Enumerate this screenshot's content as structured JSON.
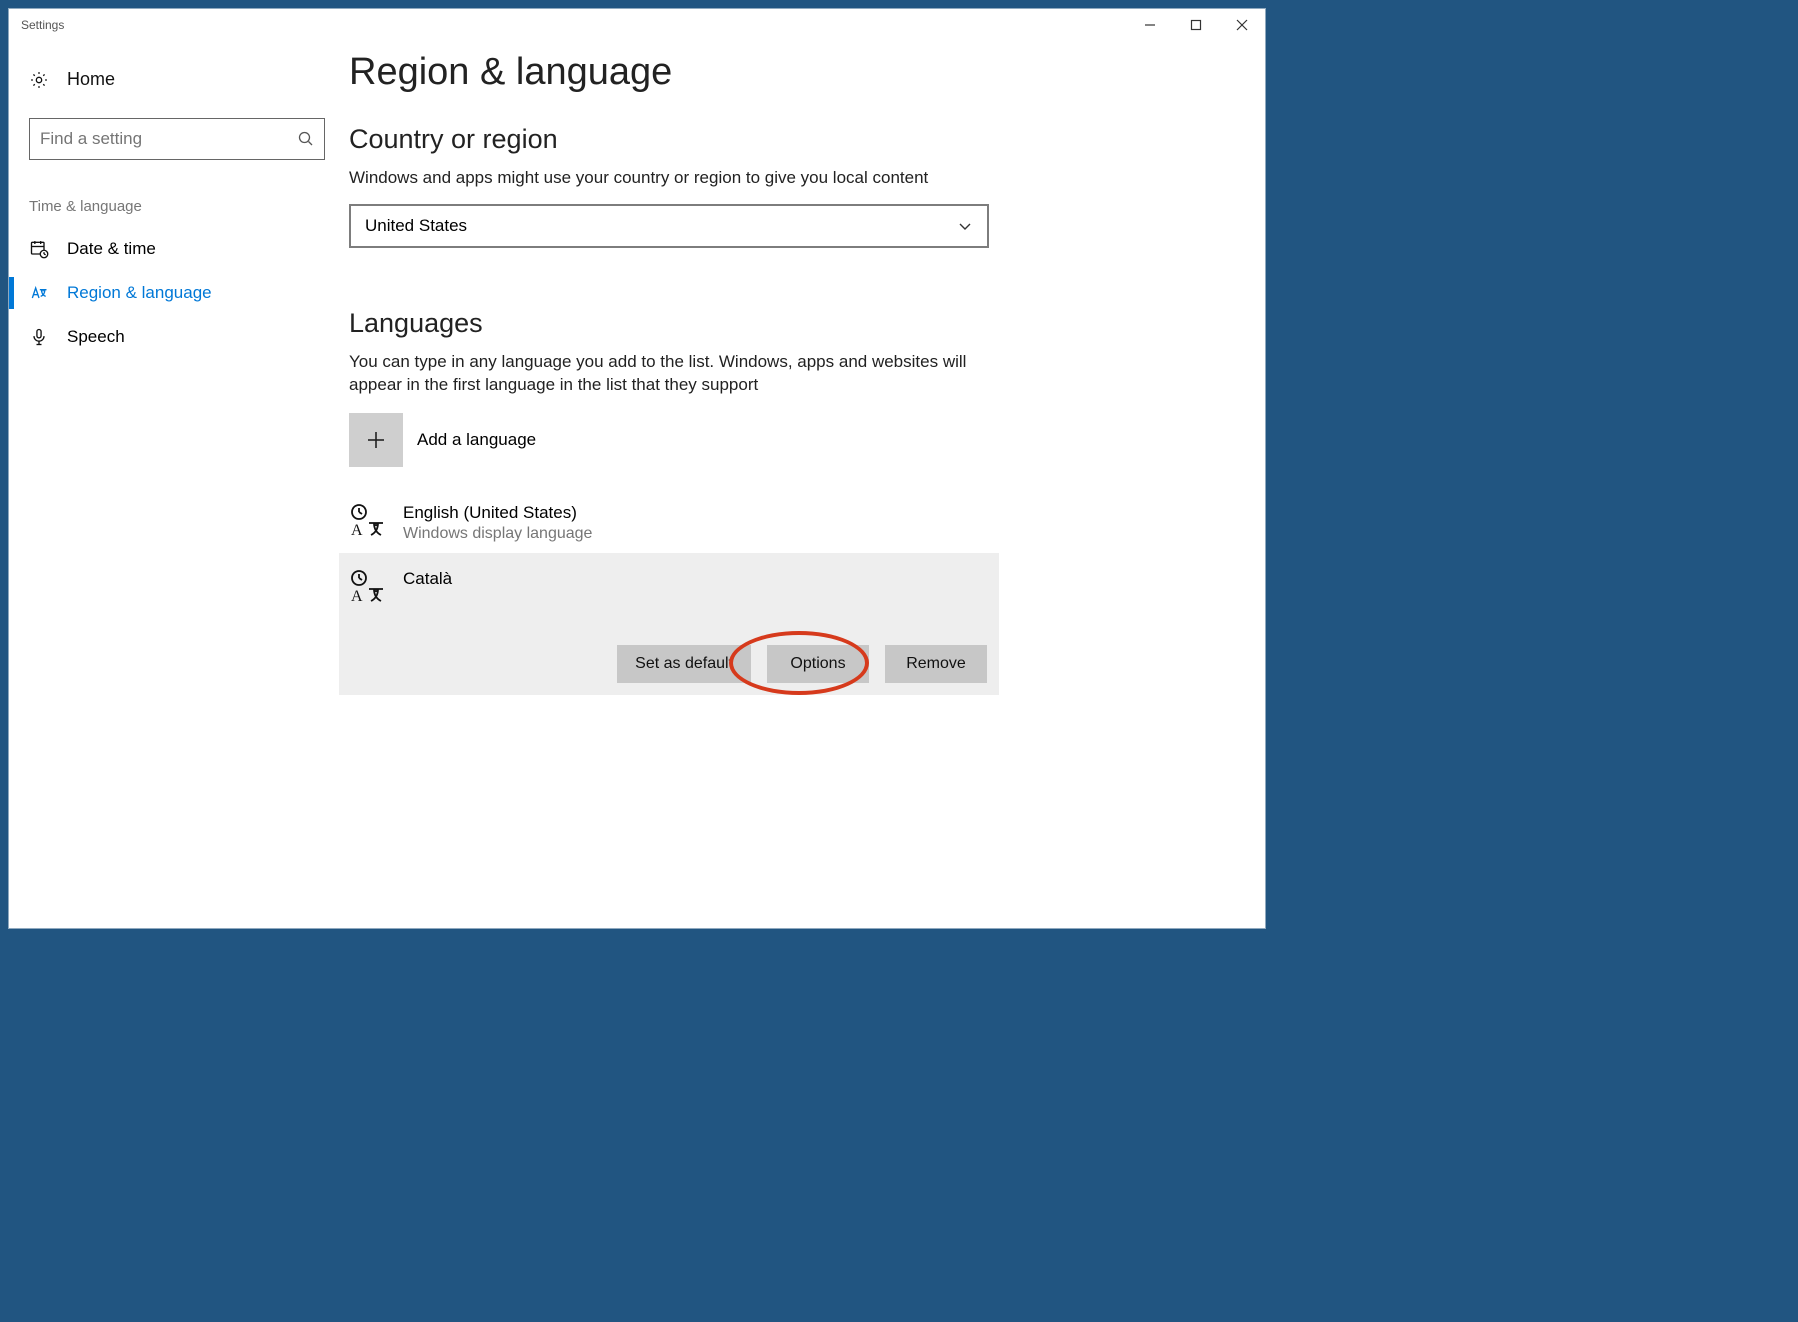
{
  "titlebar": {
    "title": "Settings"
  },
  "sidebar": {
    "home": "Home",
    "search_placeholder": "Find a setting",
    "section": "Time & language",
    "items": [
      {
        "label": "Date & time"
      },
      {
        "label": "Region & language"
      },
      {
        "label": "Speech"
      }
    ]
  },
  "main": {
    "title": "Region & language",
    "region_heading": "Country or region",
    "region_desc": "Windows and apps might use your country or region to give you local content",
    "region_selected": "United States",
    "languages_heading": "Languages",
    "languages_desc": "You can type in any language you add to the list. Windows, apps and websites will appear in the first language in the list that they support",
    "add_language": "Add a language",
    "languages": [
      {
        "name": "English (United States)",
        "sub": "Windows display language"
      },
      {
        "name": "Català",
        "sub": ""
      }
    ],
    "actions": {
      "default": "Set as default",
      "options": "Options",
      "remove": "Remove"
    }
  }
}
